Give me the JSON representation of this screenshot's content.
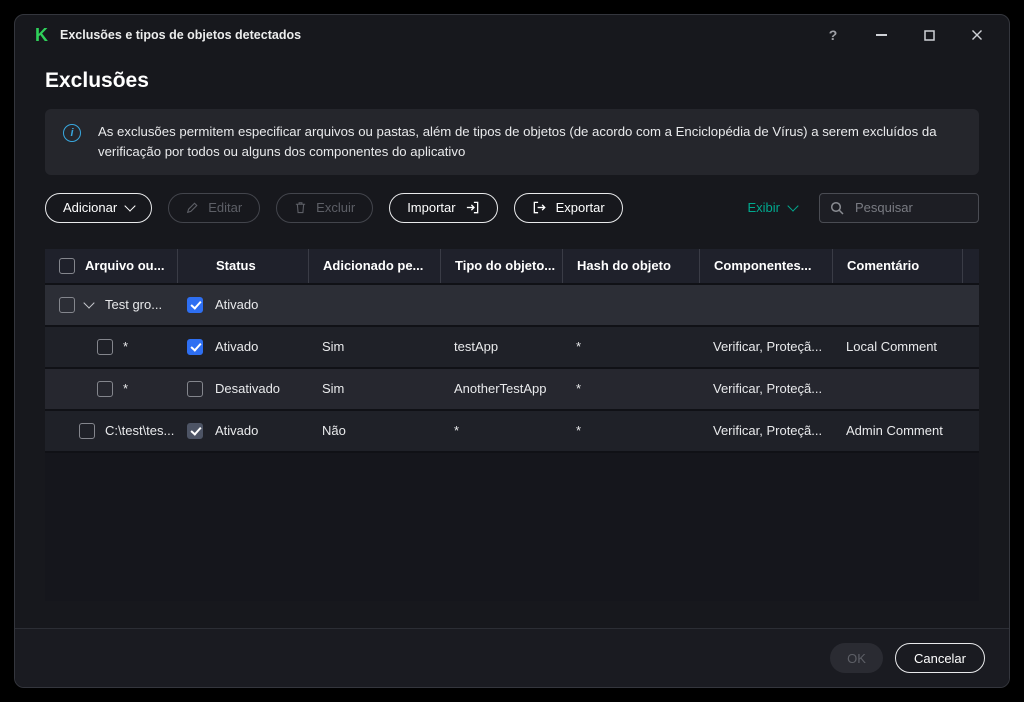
{
  "window": {
    "title": "Exclusões e tipos de objetos detectados",
    "logo_letter": "K",
    "help": "?"
  },
  "page": {
    "title": "Exclusões"
  },
  "info": {
    "icon": "i",
    "text": "As exclusões permitem especificar arquivos ou pastas, além de tipos de objetos (de acordo com a Enciclopédia de Vírus) a serem excluídos da verificação por todos ou alguns dos componentes do aplicativo"
  },
  "toolbar": {
    "add": "Adicionar",
    "edit": "Editar",
    "delete": "Excluir",
    "import": "Importar",
    "export": "Exportar",
    "view": "Exibir",
    "search_placeholder": "Pesquisar"
  },
  "table": {
    "headers": {
      "file": "Arquivo ou...",
      "status": "Status",
      "added": "Adicionado pe...",
      "type": "Tipo do objeto...",
      "hash": "Hash do objeto",
      "components": "Componentes...",
      "comment": "Comentário"
    },
    "group": {
      "name": "Test gro...",
      "status": "Ativado",
      "checked": true
    },
    "rows": [
      {
        "file": "*",
        "status": "Ativado",
        "checked": true,
        "muted": false,
        "added": "Sim",
        "type": "testApp",
        "hash": "*",
        "components": "Verificar, Proteçã...",
        "comment": "Local Comment",
        "indent": 52
      },
      {
        "file": "*",
        "status": "Desativado",
        "checked": false,
        "muted": false,
        "added": "Sim",
        "type": "AnotherTestApp",
        "hash": "*",
        "components": "Verificar, Proteçã...",
        "comment": "",
        "indent": 52
      },
      {
        "file": "C:\\test\\tes...",
        "status": "Ativado",
        "checked": true,
        "muted": true,
        "added": "Não",
        "type": "*",
        "hash": "*",
        "components": "Verificar, Proteçã...",
        "comment": "Admin Comment",
        "indent": 34
      }
    ]
  },
  "footer": {
    "ok": "OK",
    "cancel": "Cancelar"
  },
  "colors": {
    "accent_green": "#00a88e",
    "logo_green": "#2fd05a",
    "checkbox_blue": "#2e6ff2",
    "info_blue": "#38a7de"
  }
}
